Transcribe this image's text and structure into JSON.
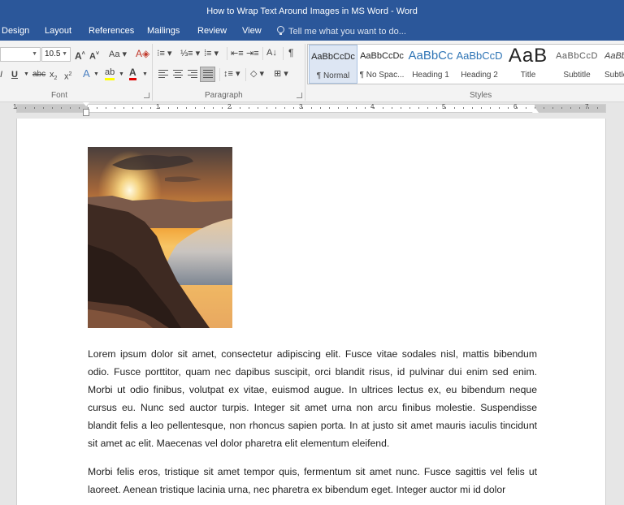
{
  "window": {
    "title": "How to Wrap Text Around Images in MS Word - Word"
  },
  "tabs": [
    "Design",
    "Layout",
    "References",
    "Mailings",
    "Review",
    "View"
  ],
  "tell_me": "Tell me what you want to do...",
  "font": {
    "size": "10.5",
    "group_label": "Font"
  },
  "paragraph": {
    "group_label": "Paragraph"
  },
  "styles": {
    "group_label": "Styles",
    "items": [
      {
        "sample": "AaBbCcDc",
        "name": "¶ Normal"
      },
      {
        "sample": "AaBbCcDc",
        "name": "¶ No Spac..."
      },
      {
        "sample": "AaBbCc",
        "name": "Heading 1"
      },
      {
        "sample": "AaBbCcD",
        "name": "Heading 2"
      },
      {
        "sample": "AaB",
        "name": "Title"
      },
      {
        "sample": "AaBbCcD",
        "name": "Subtitle"
      },
      {
        "sample": "AaBbC",
        "name": "Subtle"
      }
    ]
  },
  "ruler": {
    "numbers": [
      "1",
      "1",
      "2",
      "3",
      "4",
      "5",
      "6",
      "7"
    ]
  },
  "document": {
    "paragraphs": [
      "Lorem ipsum dolor sit amet, consectetur adipiscing elit. Fusce vitae sodales nisl, mattis bibendum odio. Fusce porttitor, quam nec dapibus suscipit, orci blandit risus, id pulvinar dui enim sed enim. Morbi ut odio finibus, volutpat ex vitae, euismod augue. In ultrices lectus ex, eu bibendum neque cursus eu. Nunc sed auctor turpis. Integer sit amet urna non arcu finibus molestie. Suspendisse blandit felis a leo pellentesque, non rhoncus sapien porta. In at justo sit amet mauris iaculis tincidunt sit amet ac elit. Maecenas vel dolor pharetra elit elementum eleifend.",
      "Morbi felis eros, tristique sit amet tempor quis, fermentum sit amet nunc. Fusce sagittis vel felis ut laoreet. Aenean tristique lacinia urna, nec pharetra ex bibendum eget. Integer auctor mi id dolor"
    ]
  },
  "colors": {
    "title_bar": "#2b579a",
    "highlight": "#ffff00",
    "font_color": "#e00000"
  }
}
